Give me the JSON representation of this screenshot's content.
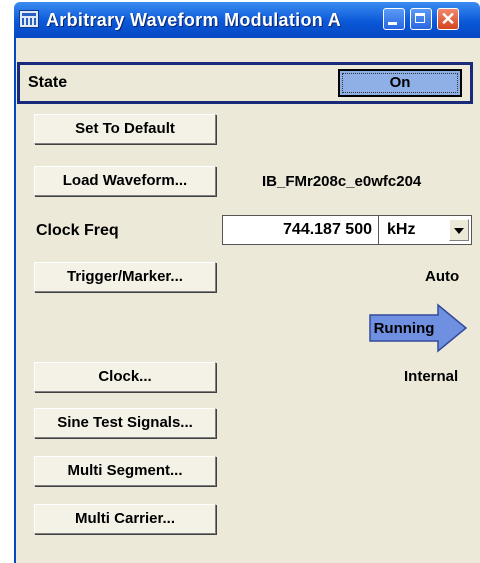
{
  "window": {
    "title": "Arbitrary Waveform Modulation  A",
    "close_glyph": "✕"
  },
  "state": {
    "label": "State",
    "value": "On"
  },
  "buttons": {
    "set_default": "Set To Default",
    "load_waveform": "Load Waveform...",
    "trigger_marker": "Trigger/Marker...",
    "clock": "Clock...",
    "sine_test": "Sine Test Signals...",
    "multi_segment": "Multi Segment...",
    "multi_carrier": "Multi Carrier..."
  },
  "waveform_name": "IB_FMr208c_e0wfc204",
  "clock_freq": {
    "label": "Clock Freq",
    "value": "744.187 500",
    "unit": "kHz"
  },
  "trigger_mode": "Auto",
  "status": {
    "label": "Running",
    "color": "#6f8fe0"
  },
  "clock_source": "Internal",
  "colors": {
    "titlebar": "#0a58d8",
    "panel": "#ece9d8",
    "state_on": "#8fb0e6"
  }
}
